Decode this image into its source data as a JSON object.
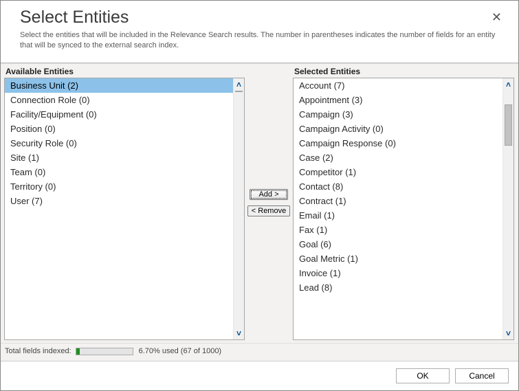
{
  "header": {
    "title": "Select Entities",
    "description": "Select the entities that will be included in the Relevance Search results. The number in parentheses indicates the number of fields for an entity that will be synced to the external search index."
  },
  "columns": {
    "available_label": "Available Entities",
    "selected_label": "Selected Entities"
  },
  "available_items": [
    "Business Unit (2)",
    "Connection Role (0)",
    "Facility/Equipment (0)",
    "Position (0)",
    "Security Role (0)",
    "Site (1)",
    "Team (0)",
    "Territory (0)",
    "User (7)"
  ],
  "selected_items": [
    "Account (7)",
    "Appointment (3)",
    "Campaign (3)",
    "Campaign Activity (0)",
    "Campaign Response (0)",
    "Case (2)",
    "Competitor (1)",
    "Contact (8)",
    "Contract (1)",
    "Email (1)",
    "Fax (1)",
    "Goal (6)",
    "Goal Metric (1)",
    "Invoice (1)",
    "Lead (8)"
  ],
  "available_selected_index": 0,
  "buttons": {
    "add": "Add >",
    "remove": "< Remove",
    "ok": "OK",
    "cancel": "Cancel"
  },
  "status": {
    "label": "Total fields indexed:",
    "percent_text": "6.70% used (67 of 1000)",
    "percent": 6.7
  }
}
